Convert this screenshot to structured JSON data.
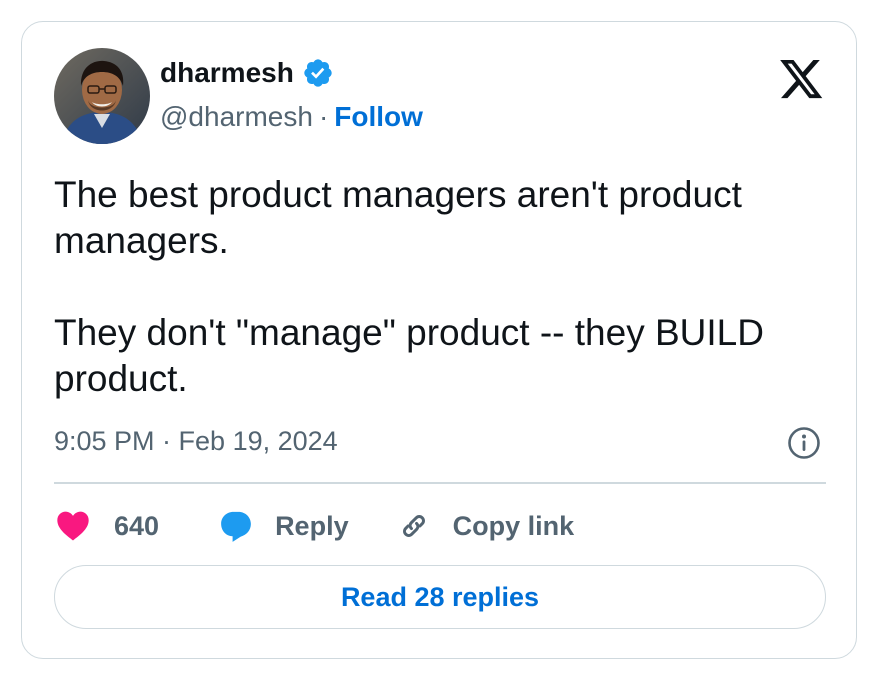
{
  "author": {
    "display_name": "dharmesh",
    "handle": "@dharmesh",
    "separator": "·",
    "follow_label": "Follow",
    "verified_color": "#1d9bf0"
  },
  "tweet": {
    "text": "The best product managers aren't product managers.\n\nThey don't \"manage\" product -- they BUILD product.",
    "timestamp": "9:05 PM · Feb 19, 2024"
  },
  "actions": {
    "like_count": "640",
    "reply_label": "Reply",
    "copy_link_label": "Copy link"
  },
  "read_replies_label": "Read 28 replies",
  "colors": {
    "text_primary": "#0f1419",
    "text_secondary": "#536471",
    "link": "#006fd6",
    "heart": "#f91880",
    "reply_bubble": "#1d9bf0",
    "border": "#cfd9de"
  },
  "icons": [
    "avatar",
    "verified-badge-icon",
    "x-logo-icon",
    "info-icon",
    "heart-icon",
    "reply-bubble-icon",
    "link-icon"
  ]
}
